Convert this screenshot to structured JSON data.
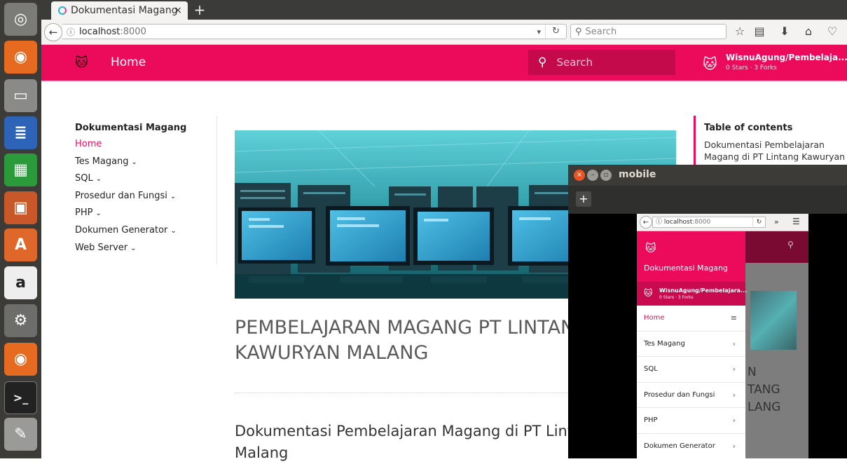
{
  "browser": {
    "tab_title": "Dokumentasi Magang",
    "tab_close": "×",
    "new_tab": "+",
    "url_host": "localhost",
    "url_port": ":8000",
    "search_placeholder": "Search"
  },
  "header": {
    "home_label": "Home",
    "search_placeholder": "Search",
    "repo_name": "WisnuAgung/Pembelaja...",
    "repo_facts": "0 Stars · 3 Forks"
  },
  "sidebar": {
    "title": "Dokumentasi Magang",
    "items": [
      {
        "label": "Home",
        "chevron": ""
      },
      {
        "label": "Tes Magang",
        "chevron": "⌄"
      },
      {
        "label": "SQL",
        "chevron": "⌄"
      },
      {
        "label": "Prosedur dan Fungsi",
        "chevron": "⌄"
      },
      {
        "label": "PHP",
        "chevron": "⌄"
      },
      {
        "label": "Dokumen Generator",
        "chevron": "⌄"
      },
      {
        "label": "Web Server",
        "chevron": "⌄"
      }
    ]
  },
  "main": {
    "title": "PEMBELAJARAN MAGANG PT LINTANG KAWURYAN MALANG",
    "subtitle": "Dokumentasi Pembelajaran Magang di PT Lintang Kawuryan Malang"
  },
  "toc": {
    "title": "Table of contents",
    "link": "Dokumentasi Pembelajaran Magang di PT Lintang Kawuryan"
  },
  "mobile_window": {
    "title": "mobile",
    "url_host": "localhost",
    "url_port": ":8000",
    "drawer_title": "Dokumentasi Magang",
    "repo_name": "WisnuAgung/Pembelajara...",
    "repo_facts": "0 Stars · 3 Forks",
    "items": [
      "Home",
      "Tes Magang",
      "SQL",
      "Prosedur dan Fungsi",
      "PHP",
      "Dokumen Generator"
    ],
    "bg_text": "N\nTANG\nLANG"
  },
  "colors": {
    "accent": "#ec0b5b",
    "accent_dark": "#c50a4b"
  }
}
